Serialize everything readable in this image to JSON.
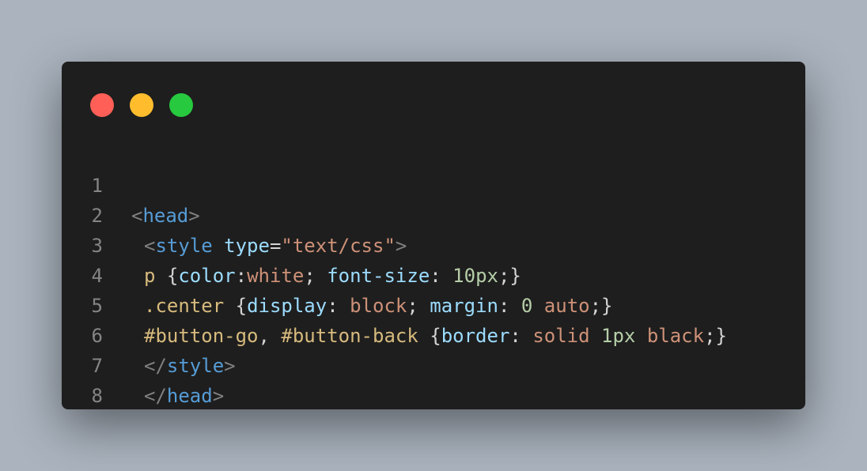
{
  "window": {
    "controls": [
      "close-dot",
      "minimize-dot",
      "maximize-dot"
    ],
    "colors": {
      "close": "#ff5f56",
      "minimize": "#ffbd2e",
      "maximize": "#27c93f",
      "background": "#1e1e1e"
    }
  },
  "code": {
    "line_numbers": [
      "1",
      "2",
      "3",
      "4",
      "5",
      "6",
      "7",
      "8"
    ],
    "l1": {
      "lt": "<",
      "tag": "head",
      "gt": ">"
    },
    "l2": {
      "lt": "<",
      "tag": "style",
      "sp": " ",
      "attr": "type",
      "eq": "=",
      "str": "\"text/css\"",
      "gt": ">"
    },
    "l3": {
      "sel": "p",
      "open": " {",
      "prop1": "color",
      "c1": ":",
      "val1": "white",
      "semi1": "; ",
      "prop2": "font-size",
      "c2": ": ",
      "num2": "10px",
      "close": ";}"
    },
    "l4": {
      "sel": ".center",
      "open": " {",
      "prop1": "display",
      "c1": ": ",
      "val1": "block",
      "semi1": "; ",
      "prop2": "margin",
      "c2": ": ",
      "num2": "0",
      "sp2": " ",
      "val2": "auto",
      "close": ";}"
    },
    "l5": {
      "sel1": "#button-go",
      "comma": ", ",
      "sel2": "#button-back",
      "open": " {",
      "prop1": "border",
      "c1": ": ",
      "val1": "solid",
      "sp1": " ",
      "num1": "1px",
      "sp2": " ",
      "val2": "black",
      "close": ";}"
    },
    "l6": {
      "lt": "</",
      "tag": "style",
      "gt": ">"
    },
    "l7": {
      "lt": "</",
      "tag": "head",
      "gt": ">"
    }
  }
}
